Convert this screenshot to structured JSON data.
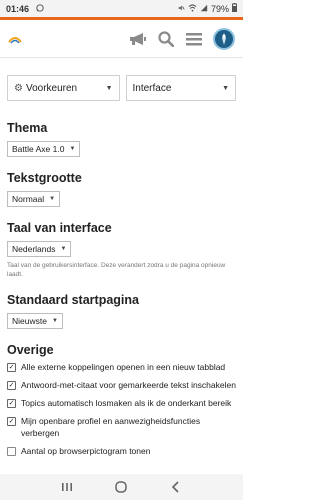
{
  "status_bar": {
    "time": "01:46",
    "battery": "79%",
    "icons": [
      "whatsapp-icon",
      "mute-icon",
      "wifi-icon",
      "signal-icon",
      "battery-icon"
    ]
  },
  "header": {
    "icons": [
      "megaphone-icon",
      "search-icon",
      "hamburger-menu-icon",
      "avatar-icon"
    ]
  },
  "top_selects": {
    "preferences": "Voorkeuren",
    "interface": "Interface"
  },
  "sections": {
    "theme": {
      "title": "Thema",
      "value": "Battle Axe 1.0"
    },
    "text_size": {
      "title": "Tekstgrootte",
      "value": "Normaal"
    },
    "language": {
      "title": "Taal van interface",
      "value": "Nederlands",
      "hint": "Taal van de gebruikersinterface. Deze verandert zodra u de pagina opnieuw laadt."
    },
    "start_page": {
      "title": "Standaard startpagina",
      "value": "Nieuwste"
    },
    "other": {
      "title": "Overige",
      "options": [
        {
          "label": "Alle externe koppelingen openen in een nieuw tabblad",
          "checked": true
        },
        {
          "label": "Antwoord-met-citaat voor gemarkeerde tekst inschakelen",
          "checked": true
        },
        {
          "label": "Topics automatisch losmaken als ik de onderkant bereik",
          "checked": true
        },
        {
          "label": "Mijn openbare profiel en aanwezigheidsfuncties verbergen",
          "checked": true
        },
        {
          "label": "Aantal op browserpictogram tonen",
          "checked": false
        }
      ]
    }
  },
  "colors": {
    "accent_bar": "#e8671a",
    "avatar_bg": "#1e5f8a"
  }
}
